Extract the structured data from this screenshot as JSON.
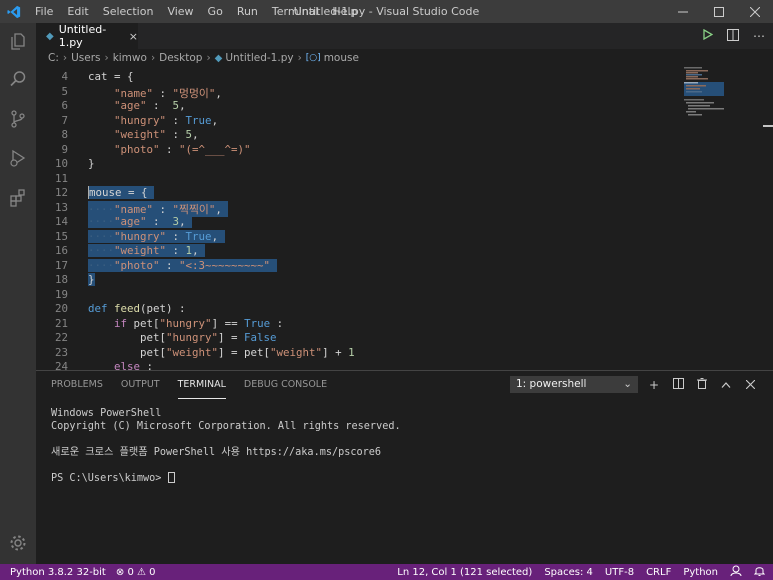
{
  "titlebar": {
    "menu": [
      "File",
      "Edit",
      "Selection",
      "View",
      "Go",
      "Run",
      "Terminal",
      "Help"
    ],
    "title": "Untitled-1.py - Visual Studio Code",
    "controls": [
      "minimize-icon",
      "maximize-icon",
      "close-icon"
    ]
  },
  "activitybar": {
    "items": [
      "explorer-icon",
      "search-icon",
      "source-control-icon",
      "run-debug-icon",
      "extensions-icon"
    ],
    "bottom": "manage-gear-icon"
  },
  "tab": {
    "label": "Untitled-1.py",
    "close": "×",
    "icon": "python-file-icon"
  },
  "editor_actions": [
    "run-icon",
    "split-editor-icon",
    "more-actions-icon"
  ],
  "breadcrumb": {
    "items": [
      "C:",
      "Users",
      "kimwo",
      "Desktop"
    ],
    "file": "Untitled-1.py",
    "symbol": "mouse"
  },
  "editor": {
    "lines": [
      {
        "num": "4",
        "text": "cat = {"
      },
      {
        "num": "5",
        "text": "    \"name\" : \"멍멍이\","
      },
      {
        "num": "6",
        "text": "    \"age\" :  5,"
      },
      {
        "num": "7",
        "text": "    \"hungry\" : True,"
      },
      {
        "num": "8",
        "text": "    \"weight\" : 5,"
      },
      {
        "num": "9",
        "text": "    \"photo\" : \"(=^___^=)\""
      },
      {
        "num": "10",
        "text": "}"
      },
      {
        "num": "11",
        "text": ""
      },
      {
        "num": "12",
        "text": "mouse = {"
      },
      {
        "num": "13",
        "text": "    \"name\" : \"찍찍이\","
      },
      {
        "num": "14",
        "text": "    \"age\" :  3,"
      },
      {
        "num": "15",
        "text": "    \"hungry\" : True,"
      },
      {
        "num": "16",
        "text": "    \"weight\" : 1,"
      },
      {
        "num": "17",
        "text": "    \"photo\" : \"<:3~~~~~~~~~\""
      },
      {
        "num": "18",
        "text": "}"
      },
      {
        "num": "19",
        "text": ""
      },
      {
        "num": "20",
        "text": "def feed(pet) :"
      },
      {
        "num": "21",
        "text": "    if pet[\"hungry\"] == True :"
      },
      {
        "num": "22",
        "text": "        pet[\"hungry\"] = False"
      },
      {
        "num": "23",
        "text": "        pet[\"weight\"] = pet[\"weight\"] + 1"
      },
      {
        "num": "24",
        "text": "    else :"
      }
    ]
  },
  "panel": {
    "tabs": [
      "PROBLEMS",
      "OUTPUT",
      "TERMINAL",
      "DEBUG CONSOLE"
    ],
    "active_tab": "TERMINAL",
    "terminal_select": "1: powershell",
    "actions": [
      "new-terminal-icon",
      "split-terminal-icon",
      "kill-terminal-icon",
      "maximize-panel-icon",
      "close-panel-icon"
    ],
    "terminal_lines": [
      "Windows PowerShell",
      "Copyright (C) Microsoft Corporation. All rights reserved.",
      "",
      "새로운 크로스 플랫폼 PowerShell 사용 https://aka.ms/pscore6",
      "",
      "PS C:\\Users\\kimwo> "
    ]
  },
  "statusbar": {
    "python": "Python 3.8.2 32-bit",
    "errors": "0",
    "warnings": "0",
    "position": "Ln 12, Col 1 (121 selected)",
    "spaces": "Spaces: 4",
    "encoding": "UTF-8",
    "eol": "CRLF",
    "language": "Python"
  },
  "colors": {
    "statusbar_bg": "#68217a",
    "selection": "#264f78",
    "accent": "#007acc"
  }
}
